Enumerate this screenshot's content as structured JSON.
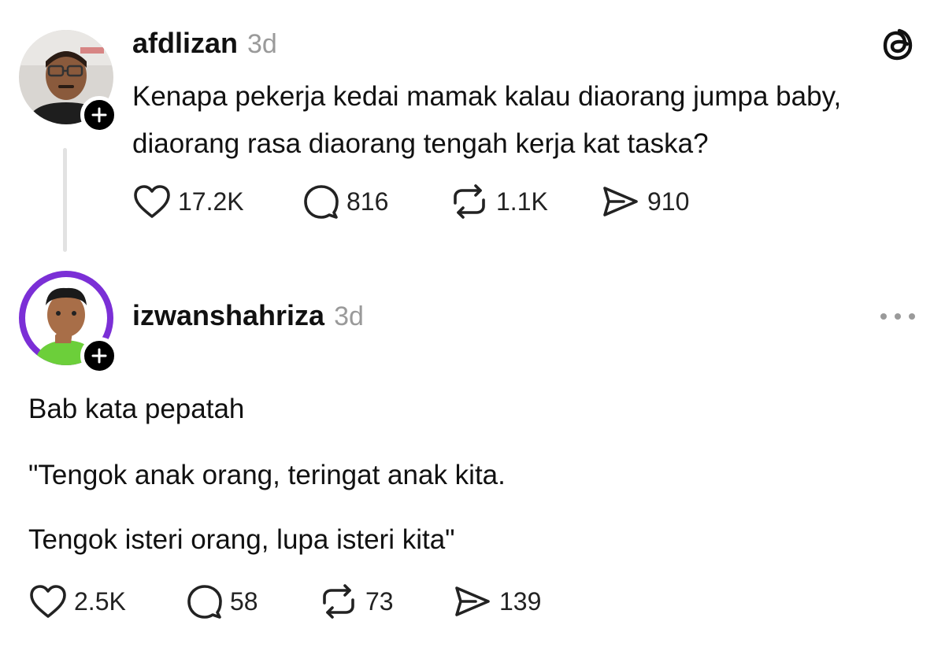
{
  "posts": [
    {
      "username": "afdlizan",
      "time": "3d",
      "text": "Kenapa pekerja kedai mamak kalau diaorang jumpa baby, diaorang rasa diaorang tengah kerja kat taska?",
      "stats": {
        "likes": "17.2K",
        "replies": "816",
        "reposts": "1.1K",
        "shares": "910"
      }
    },
    {
      "username": "izwanshahriza",
      "time": "3d",
      "paragraphs": [
        "Bab kata pepatah",
        "\"Tengok anak orang, teringat anak kita.",
        "Tengok isteri orang, lupa isteri kita\""
      ],
      "stats": {
        "likes": "2.5K",
        "replies": "58",
        "reposts": "73",
        "shares": "139"
      }
    }
  ],
  "icons": {
    "app_logo": "threads-logo-icon",
    "follow": "plus-icon",
    "like": "heart-icon",
    "reply": "comment-bubble-icon",
    "repost": "repost-icon",
    "share": "send-icon",
    "more": "more-horizontal-icon"
  },
  "colors": {
    "text": "#111111",
    "muted": "#9a9a9a",
    "thread_line": "#e2e2e2",
    "avatar2_ring": "#7b2fd6"
  }
}
